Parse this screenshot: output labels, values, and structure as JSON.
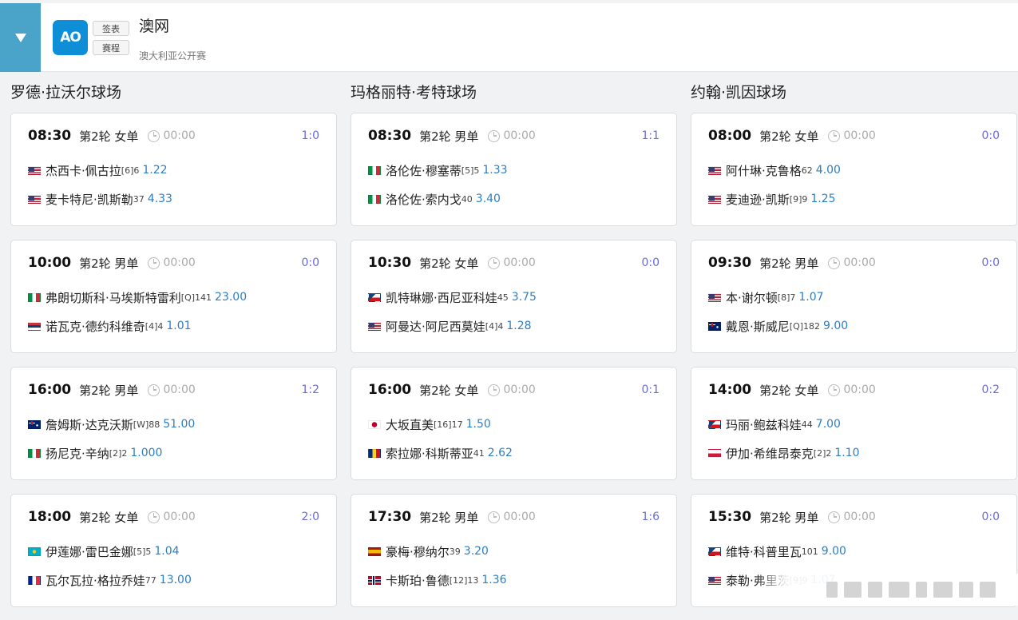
{
  "header": {
    "logo_text": "AO",
    "btn_draw": "签表",
    "btn_schedule": "赛程",
    "title": "澳网",
    "subtitle": "澳大利亚公开赛",
    "accent": "#4aa3c8",
    "logo_color": "#0e8ed6"
  },
  "courts": [
    {
      "name": "罗德·拉沃尔球场",
      "matches": [
        {
          "time": "08:30",
          "round": "第2轮 女单",
          "clock": "00:00",
          "score": "1:0",
          "p1": {
            "flag": "us",
            "name": "杰西卡·佩古拉",
            "seed": "[6]6",
            "odds": "1.22"
          },
          "p2": {
            "flag": "us",
            "name": "麦卡特尼·凯斯勒",
            "seed": "37",
            "odds": "4.33"
          }
        },
        {
          "time": "10:00",
          "round": "第2轮 男单",
          "clock": "00:00",
          "score": "0:0",
          "p1": {
            "flag": "it",
            "name": "弗朗切斯科·马埃斯特雷利",
            "seed": "[Q]141",
            "odds": "23.00"
          },
          "p2": {
            "flag": "rs",
            "name": "诺瓦克·德约科维奇",
            "seed": "[4]4",
            "odds": "1.01"
          }
        },
        {
          "time": "16:00",
          "round": "第2轮 男单",
          "clock": "00:00",
          "score": "1:2",
          "p1": {
            "flag": "au",
            "name": "詹姆斯·达克沃斯",
            "seed": "[W]88",
            "odds": "51.00"
          },
          "p2": {
            "flag": "it",
            "name": "扬尼克·辛纳",
            "seed": "[2]2",
            "odds": "1.000"
          }
        },
        {
          "time": "18:00",
          "round": "第2轮 女单",
          "clock": "00:00",
          "score": "2:0",
          "p1": {
            "flag": "kz",
            "name": "伊莲娜·雷巴金娜",
            "seed": "[5]5",
            "odds": "1.04"
          },
          "p2": {
            "flag": "fr",
            "name": "瓦尔瓦拉·格拉乔娃",
            "seed": "77",
            "odds": "13.00"
          }
        }
      ]
    },
    {
      "name": "玛格丽特·考特球场",
      "matches": [
        {
          "time": "08:30",
          "round": "第2轮 男单",
          "clock": "00:00",
          "score": "1:1",
          "p1": {
            "flag": "it",
            "name": "洛伦佐·穆塞蒂",
            "seed": "[5]5",
            "odds": "1.33"
          },
          "p2": {
            "flag": "it",
            "name": "洛伦佐·索内戈",
            "seed": "40",
            "odds": "3.40"
          }
        },
        {
          "time": "10:30",
          "round": "第2轮 女单",
          "clock": "00:00",
          "score": "0:0",
          "p1": {
            "flag": "cz",
            "name": "凯特琳娜·西尼亚科娃",
            "seed": "45",
            "odds": "3.75"
          },
          "p2": {
            "flag": "us",
            "name": "阿曼达·阿尼西莫娃",
            "seed": "[4]4",
            "odds": "1.28"
          }
        },
        {
          "time": "16:00",
          "round": "第2轮 女单",
          "clock": "00:00",
          "score": "0:1",
          "p1": {
            "flag": "jp",
            "name": "大坂直美",
            "seed": "[16]17",
            "odds": "1.50"
          },
          "p2": {
            "flag": "ro",
            "name": "索拉娜·科斯蒂亚",
            "seed": "41",
            "odds": "2.62"
          }
        },
        {
          "time": "17:30",
          "round": "第2轮 男单",
          "clock": "00:00",
          "score": "1:6",
          "p1": {
            "flag": "es",
            "name": "豪梅·穆纳尔",
            "seed": "39",
            "odds": "3.20"
          },
          "p2": {
            "flag": "no",
            "name": "卡斯珀·鲁德",
            "seed": "[12]13",
            "odds": "1.36"
          }
        }
      ]
    },
    {
      "name": "约翰·凯因球场",
      "matches": [
        {
          "time": "08:00",
          "round": "第2轮 女单",
          "clock": "00:00",
          "score": "0:0",
          "p1": {
            "flag": "us",
            "name": "阿什琳·克鲁格",
            "seed": "62",
            "odds": "4.00"
          },
          "p2": {
            "flag": "us",
            "name": "麦迪逊·凯斯",
            "seed": "[9]9",
            "odds": "1.25"
          }
        },
        {
          "time": "09:30",
          "round": "第2轮 男单",
          "clock": "00:00",
          "score": "0:0",
          "p1": {
            "flag": "us",
            "name": "本·谢尔顿",
            "seed": "[8]7",
            "odds": "1.07"
          },
          "p2": {
            "flag": "au",
            "name": "戴恩·斯威尼",
            "seed": "[Q]182",
            "odds": "9.00"
          }
        },
        {
          "time": "14:00",
          "round": "第2轮 女单",
          "clock": "00:00",
          "score": "0:2",
          "p1": {
            "flag": "cz",
            "name": "玛丽·鲍兹科娃",
            "seed": "44",
            "odds": "7.00"
          },
          "p2": {
            "flag": "pl",
            "name": "伊加·希维昂泰克",
            "seed": "[2]2",
            "odds": "1.10"
          }
        },
        {
          "time": "15:30",
          "round": "第2轮 男单",
          "clock": "00:00",
          "score": "0:0",
          "p1": {
            "flag": "cz",
            "name": "维特·科普里瓦",
            "seed": "101",
            "odds": "9.00"
          },
          "p2": {
            "flag": "us",
            "name": "泰勒·弗里茨",
            "seed": "[9]9",
            "odds": "1.07"
          }
        }
      ]
    }
  ],
  "colors": {
    "score": "#6b6bd6",
    "odds": "#2e7ec4"
  }
}
